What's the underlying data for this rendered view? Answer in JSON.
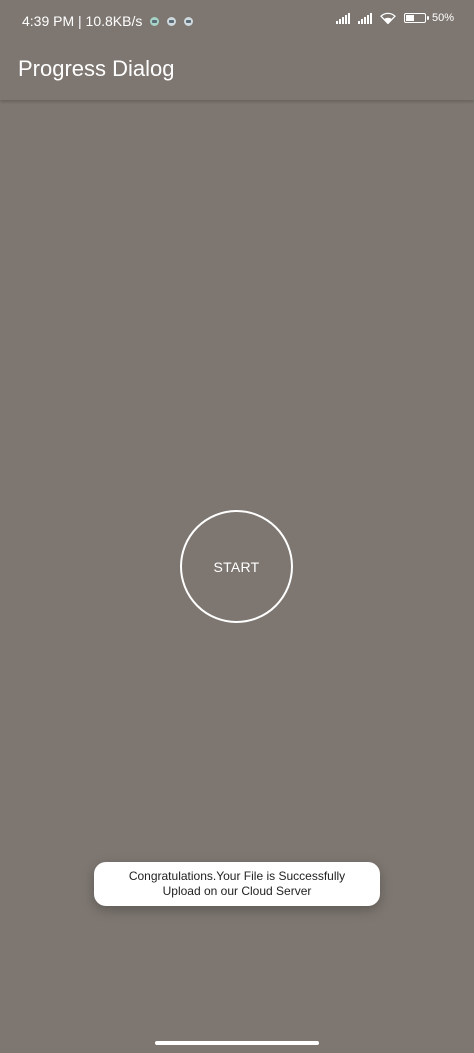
{
  "status_bar": {
    "time_speed": "4:39 PM | 10.8KB/s",
    "icons": [
      "notification-app-icon",
      "notification-app-icon",
      "notification-app-icon"
    ],
    "right_icons": [
      "signal-icon",
      "signal-icon",
      "wifi-icon",
      "battery-icon"
    ],
    "battery_level": 50,
    "battery_text": "50"
  },
  "app_bar": {
    "title": "Progress Dialog"
  },
  "main": {
    "start_button_label": "START"
  },
  "toast": {
    "message": "Congratulations.Your File is Successfully\nUpload on our Cloud Server"
  },
  "colors": {
    "background": "#7e7771",
    "text": "#ffffff",
    "toast_bg": "#ffffff",
    "toast_text": "#222222"
  }
}
